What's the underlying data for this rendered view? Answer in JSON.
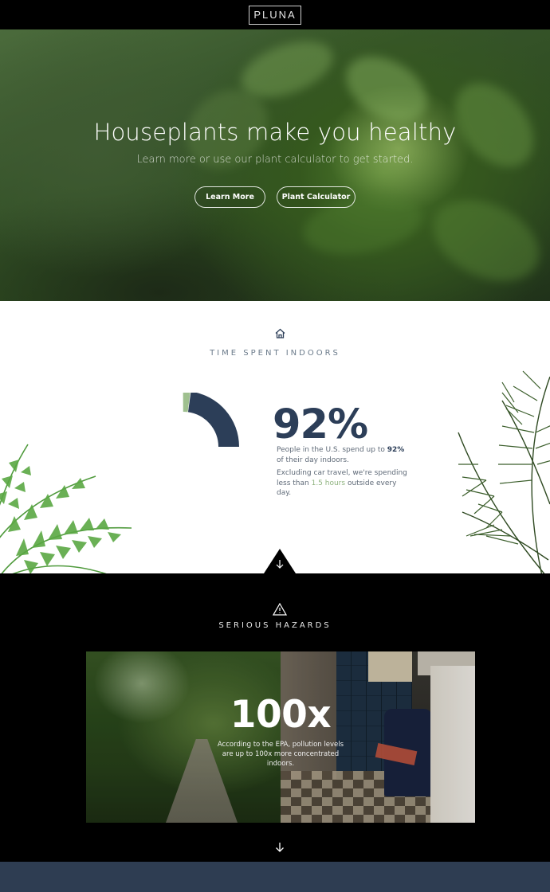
{
  "header": {
    "logo": "PLUNA"
  },
  "hero": {
    "title": "Houseplants make you healthy",
    "subtitle": "Learn more or use our plant calculator to get started.",
    "buttons": {
      "learn_more": "Learn More",
      "plant_calculator": "Plant Calculator"
    }
  },
  "indoors": {
    "icon": "house-icon",
    "label": "TIME SPENT INDOORS",
    "percent_text": "92%",
    "percent_value": 92,
    "text1_prefix": "People in the U.S. spend up to ",
    "text1_bold": "92%",
    "text1_suffix": " of their day indoors.",
    "text2_prefix": "Excluding car travel, we're spending less than ",
    "text2_highlight": "1.5 hours",
    "text2_suffix": " outside every day.",
    "colors": {
      "navy": "#2c3e58",
      "green": "#8fb37f"
    },
    "arrow_icon": "arrow-down-icon"
  },
  "hazards": {
    "icon": "warning-icon",
    "label": "SERIOUS HAZARDS",
    "big_stat": "100x",
    "text": "According to the EPA, pollution levels are up to 100x more concentrated indoors.",
    "arrow_icon": "arrow-down-icon"
  }
}
